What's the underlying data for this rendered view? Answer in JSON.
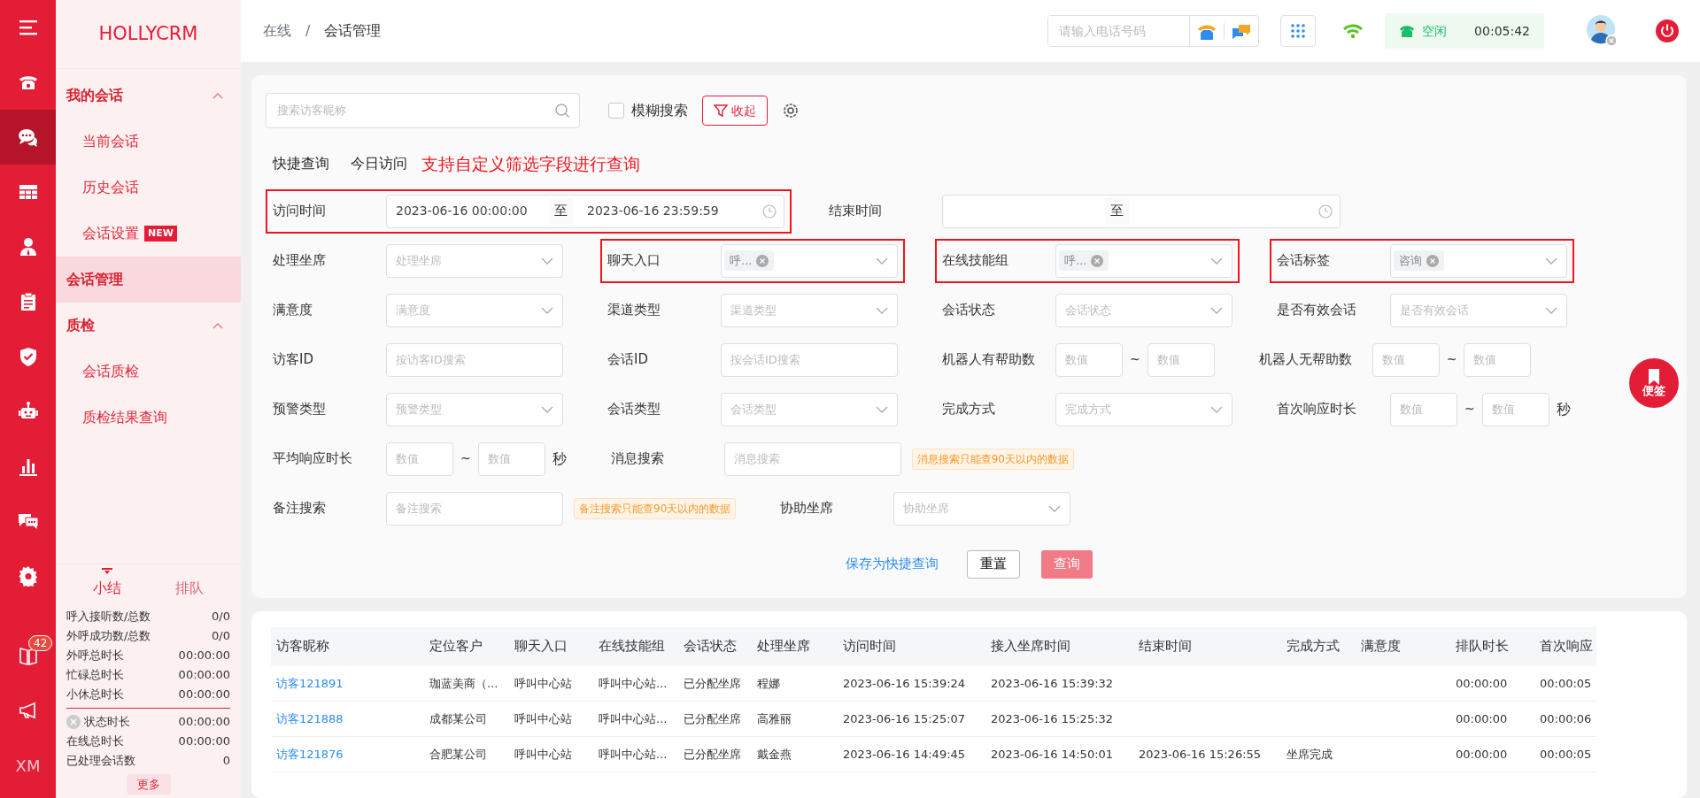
{
  "rail": {
    "items": [
      {
        "kind": "menu",
        "selected": false
      },
      {
        "kind": "phone",
        "selected": false
      },
      {
        "kind": "chat",
        "selected": true
      },
      {
        "kind": "grid",
        "selected": false
      },
      {
        "kind": "user",
        "selected": false
      },
      {
        "kind": "clipboard",
        "selected": false
      },
      {
        "kind": "shield",
        "selected": false
      },
      {
        "kind": "robot",
        "selected": false
      },
      {
        "kind": "chart",
        "selected": false
      },
      {
        "kind": "messages",
        "selected": false
      },
      {
        "kind": "gear",
        "selected": false
      },
      {
        "kind": "book",
        "selected": false,
        "badge": "42"
      },
      {
        "kind": "megaphone",
        "selected": false
      },
      {
        "kind": "text",
        "selected": false,
        "label": "XM"
      }
    ]
  },
  "sidebar": {
    "logo": "HOLLYCRM",
    "items": [
      {
        "label": "我的会话",
        "selected": false,
        "expanded": true,
        "children": [
          {
            "label": "当前会话",
            "selected": false
          },
          {
            "label": "历史会话",
            "selected": false
          },
          {
            "label": "会话设置",
            "selected": false,
            "badge": "NEW"
          }
        ]
      },
      {
        "label": "会话管理",
        "selected": true
      },
      {
        "label": "质检",
        "selected": false,
        "expanded": true,
        "children": [
          {
            "label": "会话质检",
            "selected": false
          },
          {
            "label": "质检结果查询",
            "selected": false
          }
        ]
      }
    ]
  },
  "summary": {
    "tabs": [
      {
        "label": "小结",
        "selected": true
      },
      {
        "label": "排队",
        "selected": false
      }
    ],
    "stats": [
      {
        "label": "呼入接听数/总数",
        "value": "0/0"
      },
      {
        "label": "外呼成功数/总数",
        "value": "0/0"
      },
      {
        "label": "外呼总时长",
        "value": "00:00:00"
      },
      {
        "label": "忙碌总时长",
        "value": "00:00:00"
      },
      {
        "label": "小休总时长",
        "value": "00:00:00"
      }
    ],
    "status_stats": [
      {
        "label": "状态时长",
        "value": "00:00:00",
        "kind": "status"
      },
      {
        "label": "在线总时长",
        "value": "00:00:00",
        "kind": "plain"
      },
      {
        "label": "已处理会话数",
        "value": "0",
        "kind": "plain"
      }
    ],
    "more": "更多"
  },
  "header": {
    "breadcrumb": [
      "在线",
      "会话管理"
    ],
    "separator": "/",
    "phone_placeholder": "请输入电话号码",
    "status": "空闲",
    "timer": "00:05:42"
  },
  "filters": {
    "search_placeholder": "搜索访客昵称",
    "fuzzy": {
      "label": "模糊搜索",
      "checked": false
    },
    "collapse": "收起",
    "quick": [
      "快捷查询",
      "今日访问"
    ],
    "hint": "支持自定义筛选字段进行查询",
    "rows": [
      [
        {
          "kind": "date_range",
          "label": "访问时间",
          "start": "2023-06-16 00:00:00",
          "separator": "至",
          "end": "2023-06-16 23:59:59",
          "highlighted": true
        },
        {
          "kind": "date_range",
          "label": "结束时间",
          "separator": "至",
          "highlighted": false
        }
      ],
      [
        {
          "kind": "select",
          "label": "处理坐席",
          "placeholder": "处理坐席",
          "highlighted": false
        },
        {
          "kind": "select",
          "label": "聊天入口",
          "tags": [
            "呼..."
          ],
          "highlighted": true
        },
        {
          "kind": "select",
          "label": "在线技能组",
          "tags": [
            "呼..."
          ],
          "highlighted": true
        },
        {
          "kind": "select",
          "label": "会话标签",
          "tags": [
            "咨询"
          ],
          "highlighted": true
        }
      ],
      [
        {
          "kind": "select",
          "label": "满意度",
          "placeholder": "满意度",
          "highlighted": false
        },
        {
          "kind": "select",
          "label": "渠道类型",
          "placeholder": "渠道类型",
          "highlighted": false
        },
        {
          "kind": "select",
          "label": "会话状态",
          "placeholder": "会话状态",
          "highlighted": false
        },
        {
          "kind": "select",
          "label": "是否有效会话",
          "placeholder": "是否有效会话",
          "highlighted": false
        }
      ],
      [
        {
          "kind": "input",
          "label": "访客ID",
          "placeholder": "按访客ID搜索",
          "highlighted": false
        },
        {
          "kind": "input",
          "label": "会话ID",
          "placeholder": "按会话ID搜索",
          "highlighted": false
        },
        {
          "kind": "range",
          "label": "机器人有帮助数",
          "from_placeholder": "数值",
          "separator": "~",
          "to_placeholder": "数值",
          "highlighted": false
        },
        {
          "kind": "range",
          "label": "机器人无帮助数",
          "from_placeholder": "数值",
          "separator": "~",
          "to_placeholder": "数值",
          "highlighted": false
        }
      ],
      [
        {
          "kind": "select",
          "label": "预警类型",
          "placeholder": "预警类型",
          "highlighted": false
        },
        {
          "kind": "select",
          "label": "会话类型",
          "placeholder": "会话类型",
          "highlighted": false
        },
        {
          "kind": "select",
          "label": "完成方式",
          "placeholder": "完成方式",
          "highlighted": false
        },
        {
          "kind": "range",
          "label": "首次响应时长",
          "from_placeholder": "数值",
          "separator": "~",
          "to_placeholder": "数值",
          "unit": "秒",
          "highlighted": false
        }
      ],
      [
        {
          "kind": "range",
          "label": "平均响应时长",
          "from_placeholder": "数值",
          "separator": "~",
          "to_placeholder": "数值",
          "unit": "秒",
          "highlighted": false
        },
        {
          "kind": "input",
          "label": "消息搜索",
          "placeholder": "消息搜索",
          "note": "消息搜索只能查90天以内的数据",
          "highlighted": false
        }
      ],
      [
        {
          "kind": "input",
          "label": "备注搜索",
          "placeholder": "备注搜索",
          "note": "备注搜索只能查90天以内的数据",
          "highlighted": false
        },
        {
          "kind": "select",
          "label": "协助坐席",
          "placeholder": "协助坐席",
          "highlighted": false
        }
      ]
    ],
    "save": "保存为快捷查询",
    "reset": "重置",
    "query": "查询"
  },
  "table": {
    "columns": [
      "访客昵称",
      "定位客户",
      "聊天入口",
      "在线技能组",
      "会话状态",
      "处理坐席",
      "访问时间",
      "接入坐席时间",
      "结束时间",
      "完成方式",
      "满意度",
      "排队时长",
      "首次响应"
    ],
    "rows": [
      [
        "访客121891",
        "珈蓝美商（...",
        "呼叫中心站",
        "呼叫中心站...",
        "已分配坐席",
        "程娜",
        "2023-06-16 15:39:24",
        "2023-06-16 15:39:32",
        "",
        "",
        "",
        "00:00:00",
        "00:00:05"
      ],
      [
        "访客121888",
        "成都某公司",
        "呼叫中心站",
        "呼叫中心站...",
        "已分配坐席",
        "高雅丽",
        "2023-06-16 15:25:07",
        "2023-06-16 15:25:32",
        "",
        "",
        "",
        "00:00:00",
        "00:00:06"
      ],
      [
        "访客121876",
        "合肥某公司",
        "呼叫中心站",
        "呼叫中心站...",
        "已分配坐席",
        "戴金燕",
        "2023-06-16 14:49:45",
        "2023-06-16 14:50:01",
        "2023-06-16 15:26:55",
        "坐席完成",
        "",
        "00:00:00",
        "00:00:05"
      ]
    ]
  },
  "note_button": "便签"
}
